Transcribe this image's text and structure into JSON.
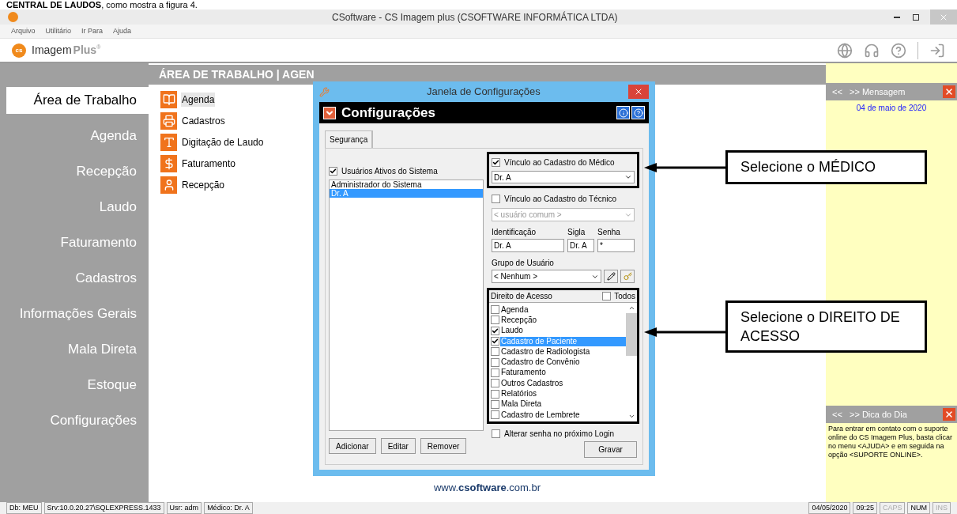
{
  "caption": "**CENTRAL DE LAUDOS**, como mostra a figura 4.",
  "window": {
    "title": "CSoftware - CS Imagem plus (CSOFTWARE INFORMÁTICA LTDA)"
  },
  "menu": [
    "Arquivo",
    "Utilitário",
    "Ir Para",
    "Ajuda"
  ],
  "logo": {
    "name": "Imagem",
    "suffix": "Plus",
    "mark": "®",
    "badge": "cs"
  },
  "sidebar": {
    "items": [
      {
        "label": "Área de Trabalho",
        "selected": true
      },
      {
        "label": "Agenda",
        "selected": false
      },
      {
        "label": "Recepção",
        "selected": false
      },
      {
        "label": "Laudo",
        "selected": false
      },
      {
        "label": "Faturamento",
        "selected": false
      },
      {
        "label": "Cadastros",
        "selected": false
      },
      {
        "label": "Informações Gerais",
        "selected": false
      },
      {
        "label": "Mala Direta",
        "selected": false
      },
      {
        "label": "Estoque",
        "selected": false
      },
      {
        "label": "Configurações",
        "selected": false
      }
    ]
  },
  "breadcrumb": "ÁREA DE TRABALHO | AGEN",
  "shortcuts": [
    {
      "label": "Agenda",
      "kind": "book",
      "selected": true
    },
    {
      "label": "Cadastros",
      "kind": "printer",
      "selected": false
    },
    {
      "label": "Digitação de Laudo",
      "kind": "type",
      "selected": false
    },
    {
      "label": "Faturamento",
      "kind": "dollar",
      "selected": false
    },
    {
      "label": "Recepção",
      "kind": "person",
      "selected": false
    }
  ],
  "footer": "www.**csoftware**.com.br",
  "message_panel": {
    "nav": "<<   >> Mensagem",
    "date": "04 de maio de 2020"
  },
  "tip_panel": {
    "nav": "<<   >> Dica do Dia",
    "text": "Para entrar em contato com o suporte online do CS Imagem Plus, basta clicar no menu <AJUDA> e em seguida na opção <SUPORTE ONLINE>."
  },
  "dialog": {
    "title": "Janela de Configurações",
    "header": "Configurações",
    "tab": "Segurança",
    "active_users": {
      "label": "Usuários Ativos do Sistema",
      "checked": true
    },
    "users": [
      {
        "name": "Administrador do Sistema",
        "selected": false
      },
      {
        "name": "Dr. A",
        "selected": true
      }
    ],
    "doctor_link": {
      "label": "Vínculo ao Cadastro do Médico",
      "checked": true,
      "value": "Dr. A"
    },
    "tech_link": {
      "label": "Vínculo ao Cadastro do Técnico",
      "checked": false,
      "value": "< usuário comum >"
    },
    "fields": [
      {
        "label": "Identificação",
        "value": "Dr. A"
      },
      {
        "label": "Sigla",
        "value": "Dr. A"
      },
      {
        "label": "Senha",
        "value": "*"
      }
    ],
    "group": {
      "label": "Grupo de Usuário",
      "value": "< Nenhum >"
    },
    "access": {
      "label": "Direito de Acesso",
      "all_label": "Todos",
      "all_checked": false,
      "items": [
        {
          "label": "Agenda",
          "checked": false,
          "selected": false
        },
        {
          "label": "Recepção",
          "checked": false,
          "selected": false
        },
        {
          "label": "Laudo",
          "checked": true,
          "selected": false
        },
        {
          "label": "Cadastro de Paciente",
          "checked": true,
          "selected": true
        },
        {
          "label": "Cadastro de Radiologista",
          "checked": false,
          "selected": false
        },
        {
          "label": "Cadastro de Convênio",
          "checked": false,
          "selected": false
        },
        {
          "label": "Faturamento",
          "checked": false,
          "selected": false
        },
        {
          "label": "Outros Cadastros",
          "checked": false,
          "selected": false
        },
        {
          "label": "Relatórios",
          "checked": false,
          "selected": false
        },
        {
          "label": "Mala Direta",
          "checked": false,
          "selected": false
        },
        {
          "label": "Cadastro de Lembrete",
          "checked": false,
          "selected": false
        }
      ]
    },
    "change_password": {
      "label": "Alterar senha no próximo Login",
      "checked": false
    },
    "buttons": [
      "Adicionar",
      "Editar",
      "Remover"
    ],
    "save": "Gravar"
  },
  "callouts": [
    "Selecione o MÉDICO",
    "Selecione o DIREITO DE ACESSO"
  ],
  "status_bar": {
    "left": [
      {
        "text": "Db: MEU",
        "active": true
      },
      {
        "text": "Srv:10.0.20.27\\SQLEXPRESS.1433",
        "active": true
      },
      {
        "text": "Usr: adm",
        "active": true
      },
      {
        "text": "Médico: Dr. A",
        "active": true
      }
    ],
    "right": [
      {
        "text": "04/05/2020",
        "active": true
      },
      {
        "text": "09:25",
        "active": true
      },
      {
        "text": "CAPS",
        "active": false
      },
      {
        "text": "NUM",
        "active": true
      },
      {
        "text": "INS",
        "active": false
      }
    ]
  }
}
